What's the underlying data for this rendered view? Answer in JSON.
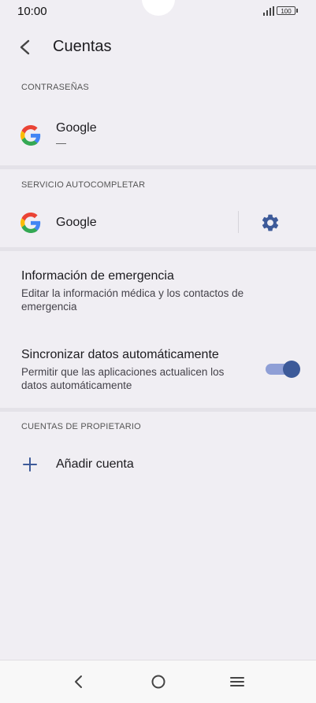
{
  "status_bar": {
    "time": "10:00",
    "battery": "100"
  },
  "app_bar": {
    "title": "Cuentas"
  },
  "passwords": {
    "header": "CONTRASEÑAS",
    "item": {
      "title": "Google",
      "subtitle": "—"
    }
  },
  "autofill": {
    "header": "SERVICIO AUTOCOMPLETAR",
    "item": {
      "title": "Google"
    }
  },
  "emergency": {
    "title": "Información de emergencia",
    "subtitle": "Editar la información médica y los contactos de emergencia"
  },
  "sync": {
    "title": "Sincronizar datos automáticamente",
    "subtitle": "Permitir que las aplicaciones actualicen los datos automáticamente",
    "enabled": true
  },
  "owner_accounts": {
    "header": "CUENTAS DE PROPIETARIO",
    "add_label": "Añadir cuenta"
  },
  "colors": {
    "background": "#f0eef3",
    "accent": "#3d5a99",
    "switch_track": "#8f9fd6"
  },
  "icons": [
    "back-arrow-icon",
    "google-logo-icon",
    "gear-icon",
    "plus-icon",
    "nav-back-icon",
    "nav-home-icon",
    "nav-menu-icon"
  ]
}
